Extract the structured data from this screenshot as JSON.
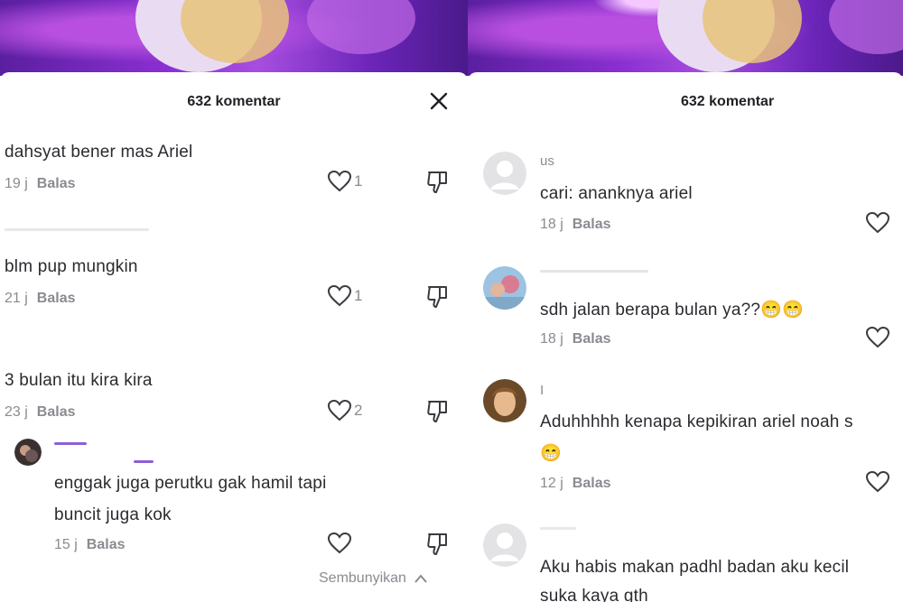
{
  "left": {
    "comment_count": "632 komentar",
    "comments": [
      {
        "text": "dahsyat bener mas Ariel",
        "time": "19 j",
        "reply": "Balas",
        "likes": "1"
      },
      {
        "text": "blm pup mungkin",
        "time": "21 j",
        "reply": "Balas",
        "likes": "1"
      },
      {
        "text": "3 bulan itu kira kira",
        "time": "23 j",
        "reply": "Balas",
        "likes": "2"
      }
    ],
    "reply": {
      "text_line1": "enggak juga perutku gak hamil tapi",
      "text_line2": "buncit juga kok",
      "time": "15 j",
      "reply": "Balas"
    },
    "hide_label": "Sembunyikan"
  },
  "right": {
    "comment_count": "632 komentar",
    "comments": [
      {
        "username": "us",
        "text": "cari: ananknya ariel",
        "time": "18 j",
        "reply": "Balas"
      },
      {
        "text": "sdh jalan berapa bulan ya??😁😁",
        "time": "18 j",
        "reply": "Balas"
      },
      {
        "username": "I",
        "text_line1": "Aduhhhhh kenapa kepikiran ariel noah s",
        "text_line2": "😁",
        "time": "12 j",
        "reply": "Balas"
      },
      {
        "text_line1": "Aku habis makan padhl badan aku kecil",
        "text_line2": "suka kaya gth"
      }
    ]
  },
  "icons": {
    "close": "close-icon",
    "heart": "heart-icon",
    "dislike": "dislike-icon",
    "chevron": "chevron-up-icon",
    "avatar_placeholder": "default-avatar-icon"
  }
}
